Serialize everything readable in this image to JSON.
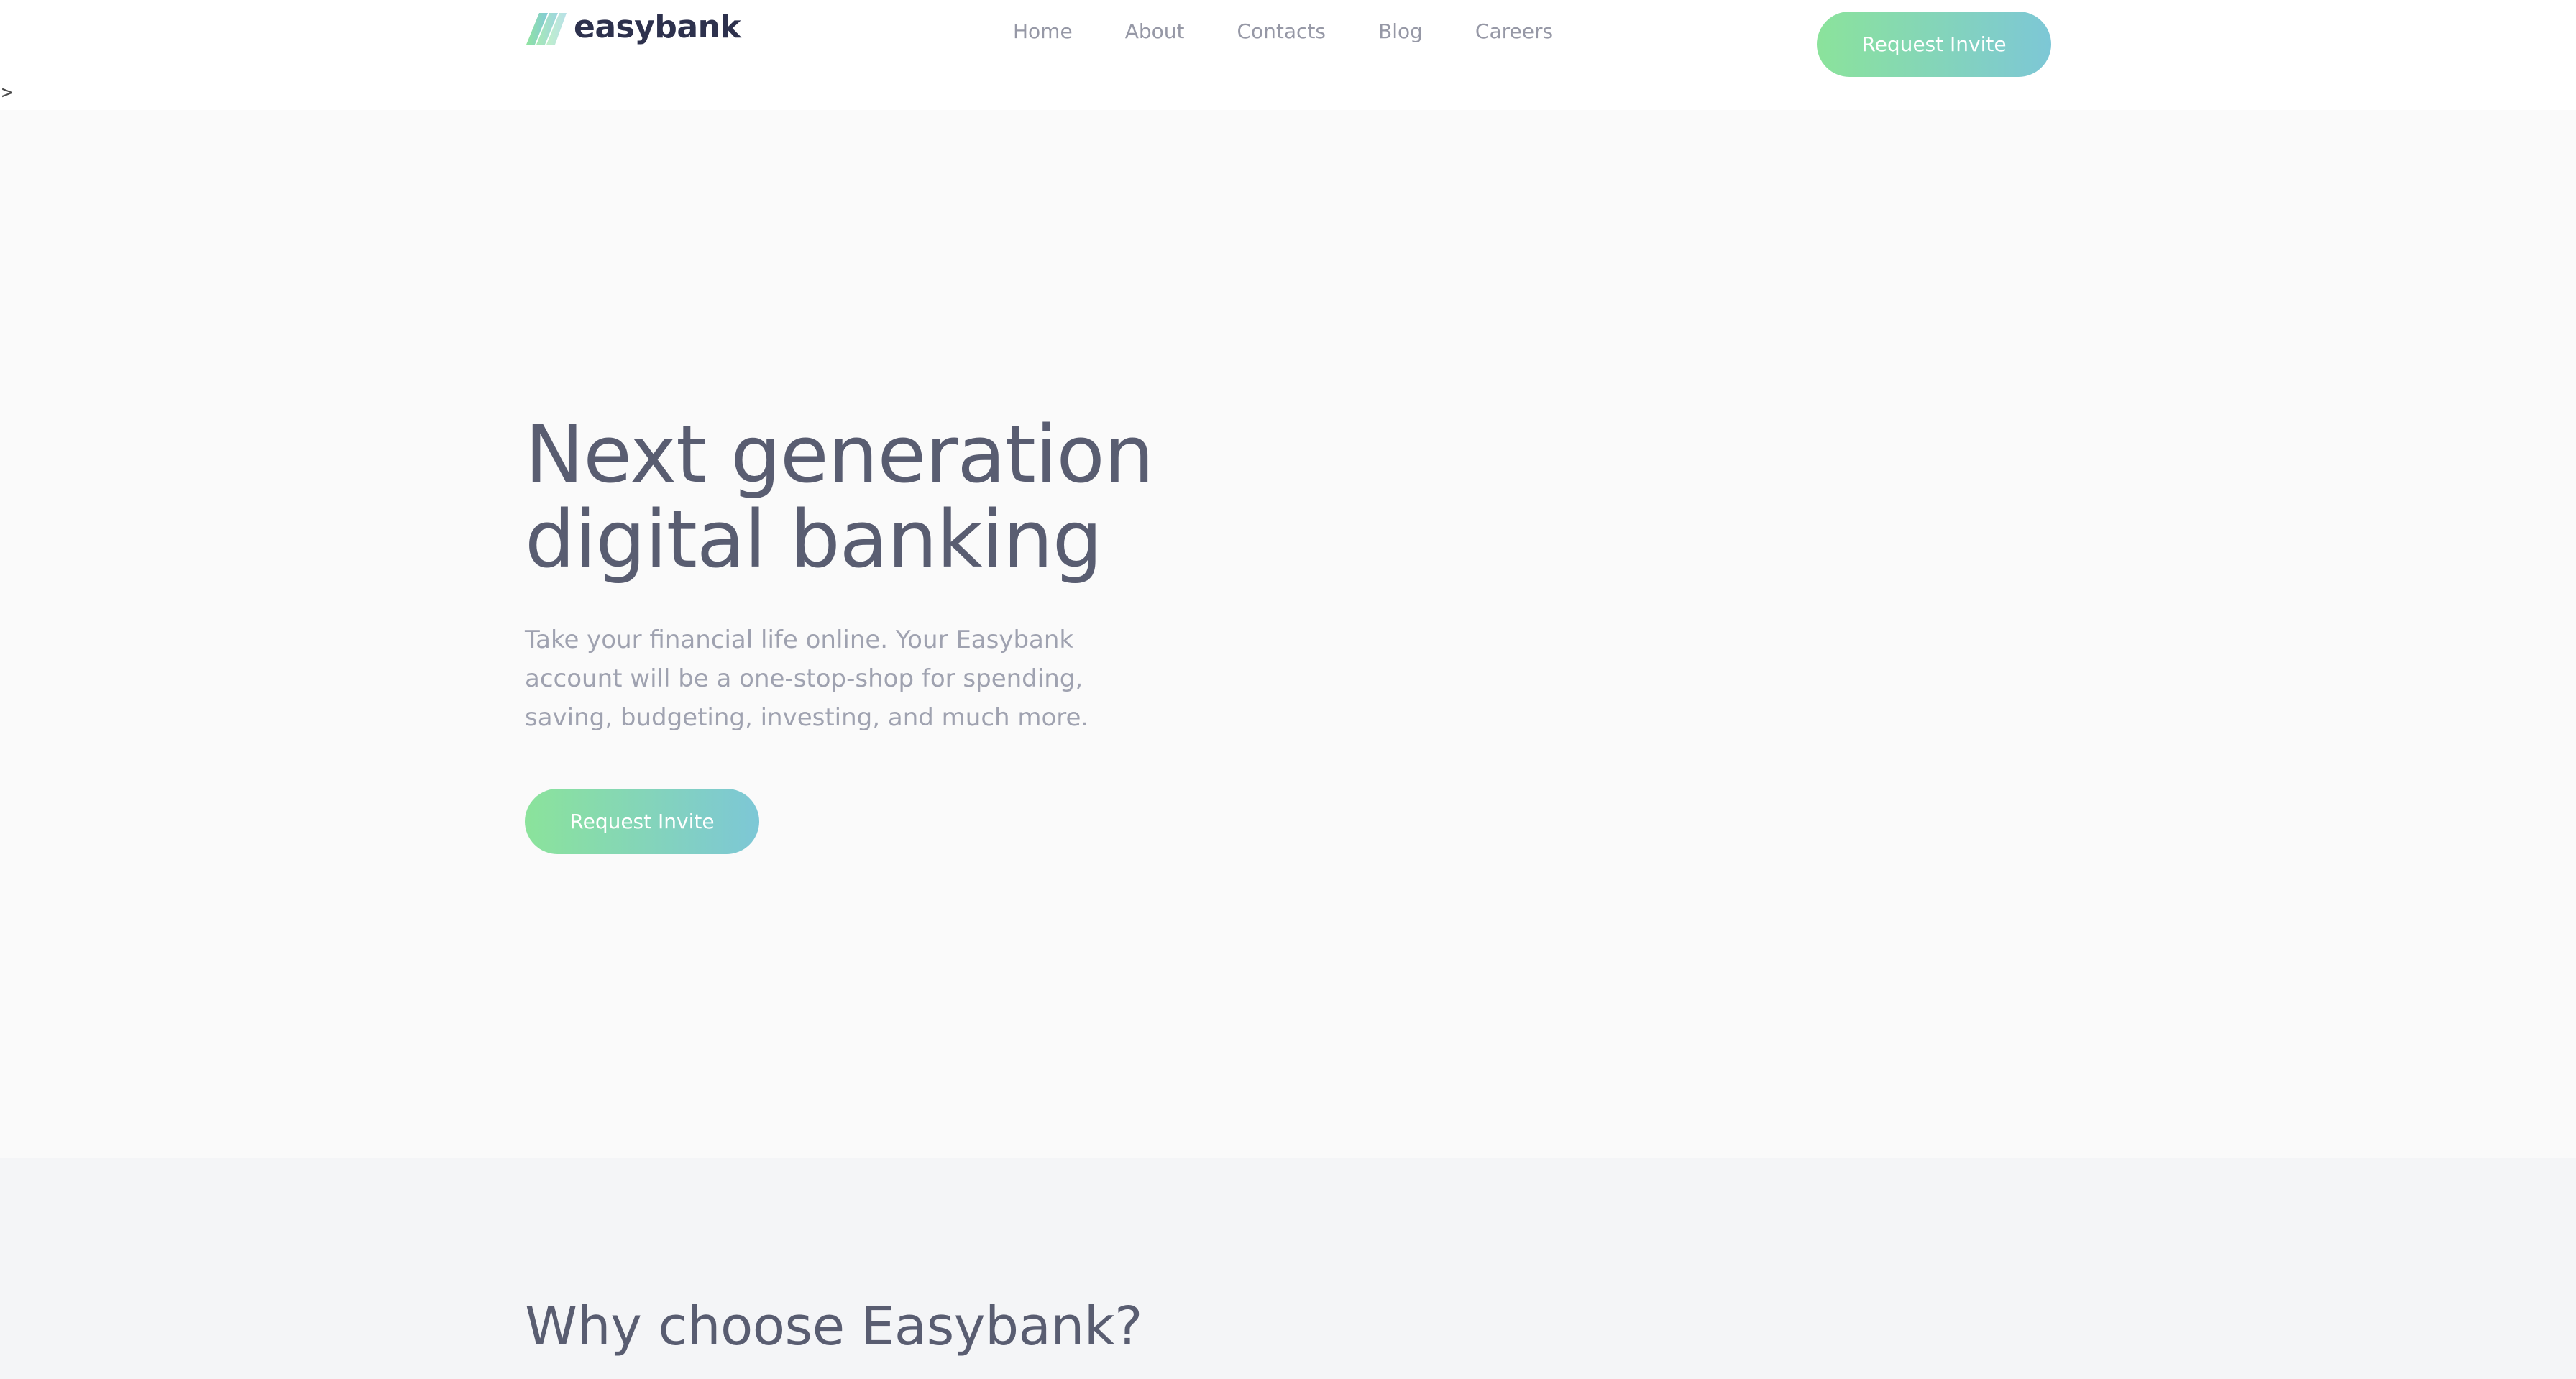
{
  "header": {
    "logo_text": "easybank",
    "nav": [
      {
        "label": "Home"
      },
      {
        "label": "About"
      },
      {
        "label": "Contacts"
      },
      {
        "label": "Blog"
      },
      {
        "label": "Careers"
      }
    ],
    "cta_label": "Request Invite"
  },
  "stray_text": ">",
  "hero": {
    "title_line1": "Next generation",
    "title_line2": "digital banking",
    "body": "Take your financial life online. Your Easybank account will be a one-stop-shop for spending, saving, budgeting, investing, and much more.",
    "cta_label": "Request Invite"
  },
  "why": {
    "title": "Why choose Easybank?"
  },
  "colors": {
    "text_dark": "#2d314d",
    "text_heading": "#595d71",
    "text_muted": "#9698a6",
    "gradient_start": "#8be39b",
    "gradient_end": "#7dc7d6",
    "hero_bg": "#fafafa",
    "section_bg": "#f4f5f7"
  }
}
